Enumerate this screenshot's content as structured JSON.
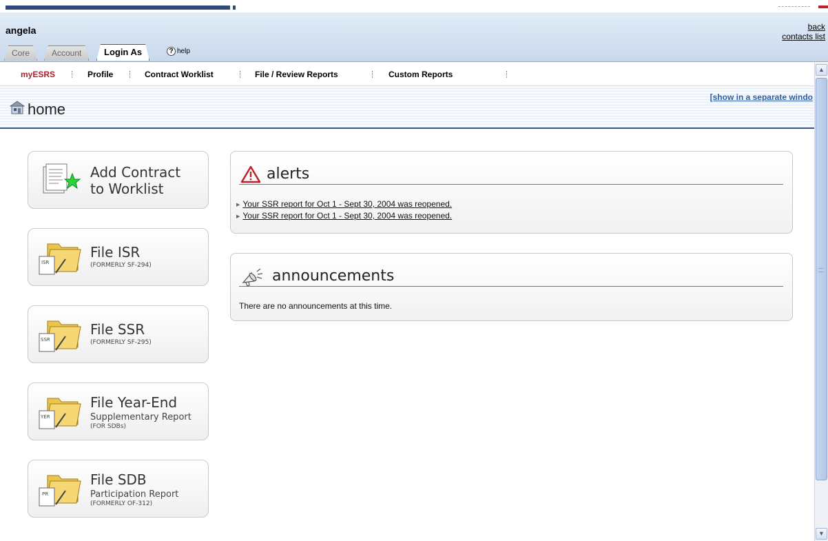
{
  "header": {
    "username": "angela",
    "back_label": "back",
    "contacts_label": "contacts list",
    "tabs": [
      {
        "label": "Core"
      },
      {
        "label": "Account"
      },
      {
        "label": "Login As"
      }
    ],
    "help_label": "help"
  },
  "nav": {
    "items": [
      {
        "label": "myESRS",
        "active": true
      },
      {
        "label": "Profile"
      },
      {
        "label": "Contract Worklist"
      },
      {
        "label": "File / Review Reports"
      },
      {
        "label": "Custom Reports"
      }
    ]
  },
  "page": {
    "title": "home",
    "separate_window_label": "[show in a separate windo"
  },
  "cards": [
    {
      "title": "Add Contract",
      "subtitle": "to Worklist",
      "note": ""
    },
    {
      "title": "File ISR",
      "subtitle": "",
      "note": "(FORMERLY SF-294)",
      "badge": "ISR"
    },
    {
      "title": "File SSR",
      "subtitle": "",
      "note": "(FORMERLY SF-295)",
      "badge": "SSR"
    },
    {
      "title": "File Year-End",
      "subtitle": "Supplementary Report",
      "note": "(FOR SDBs)",
      "badge": "YER"
    },
    {
      "title": "File SDB",
      "subtitle": "Participation Report",
      "note": "(FORMERLY OF-312)",
      "badge": "PR"
    }
  ],
  "alerts": {
    "title": "alerts",
    "items": [
      "Your SSR report for Oct 1 - Sept 30, 2004 was reopened.",
      "Your SSR report for Oct 1 - Sept 30, 2004 was reopened."
    ]
  },
  "announcements": {
    "title": "announcements",
    "message": "There are no announcements at this time."
  },
  "colors": {
    "nav_active": "#b0202a",
    "header_bg": "#d4e1f1",
    "link_blue": "#2d5fa8",
    "title_rule": "#3e5883"
  }
}
